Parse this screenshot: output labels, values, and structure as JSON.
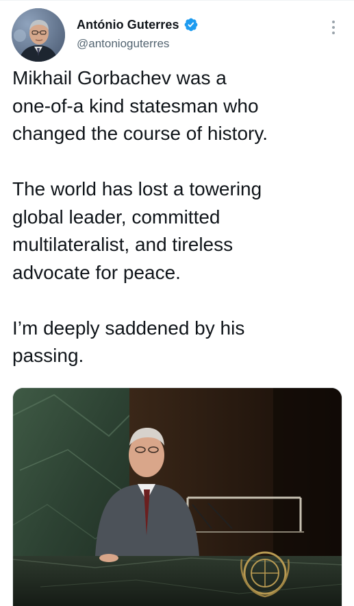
{
  "author": {
    "display_name": "António Guterres",
    "handle": "@antonioguterres",
    "verified": true,
    "verified_icon": "verified-badge-icon",
    "avatar_icon": "avatar-portrait"
  },
  "tweet": {
    "text": "Mikhail Gorbachev was a\none-of-a kind statesman who\nchanged the course of history.\n\nThe world has lost a towering\nglobal leader, committed\nmultilateralist, and tireless\nadvocate for peace.\n\nI’m deeply saddened by his\npassing."
  },
  "media": {
    "type": "photo",
    "subject": "speaker-at-podium-photo"
  },
  "menu": {
    "icon": "more-options-icon"
  },
  "colors": {
    "verified": "#1d9bf0",
    "text": "#0f1419",
    "secondary": "#536471"
  }
}
